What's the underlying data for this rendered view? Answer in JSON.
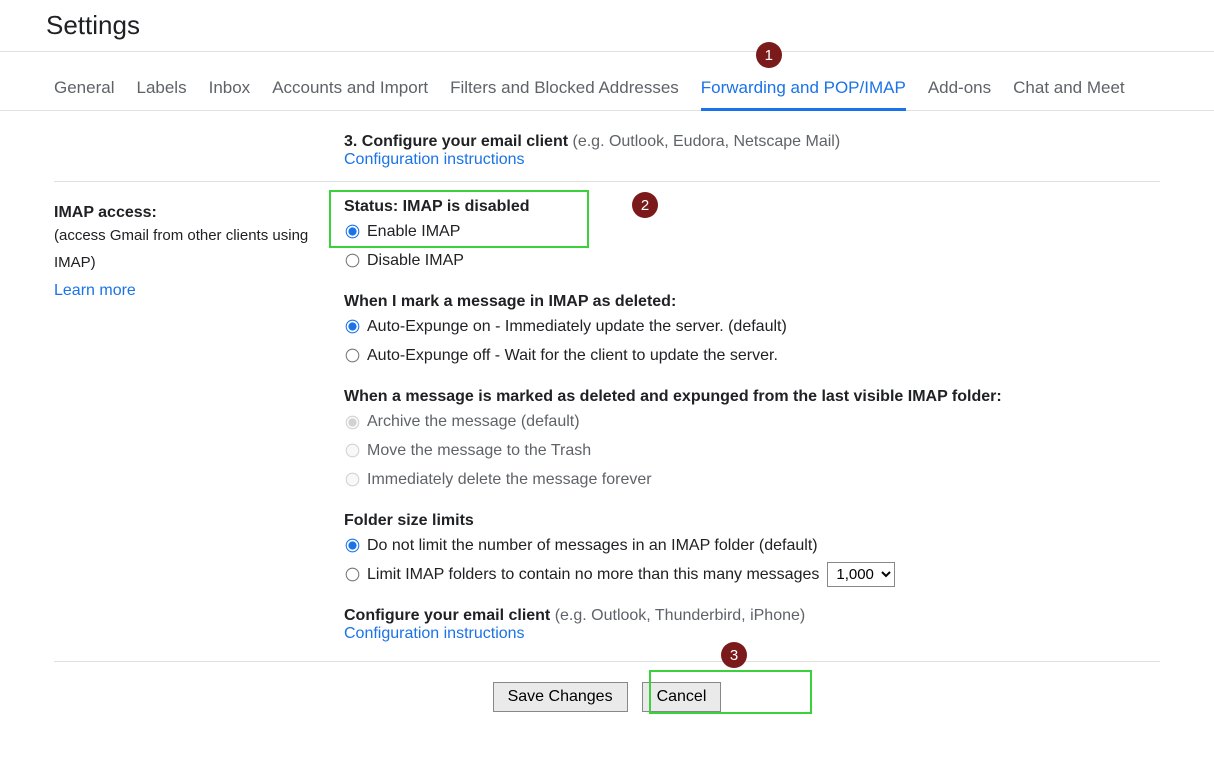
{
  "page": {
    "title": "Settings"
  },
  "tabs": {
    "general": "General",
    "labels": "Labels",
    "inbox": "Inbox",
    "accounts": "Accounts and Import",
    "filters": "Filters and Blocked Addresses",
    "forwarding": "Forwarding and POP/IMAP",
    "addons": "Add-ons",
    "chat": "Chat and Meet"
  },
  "pop": {
    "step3_label": "3. Configure your email client ",
    "step3_example": "(e.g. Outlook, Eudora, Netscape Mail)",
    "config_link": "Configuration instructions"
  },
  "imap": {
    "left_label": "IMAP access:",
    "left_sub": "(access Gmail from other clients using IMAP)",
    "learn_more": "Learn more",
    "status_label": "Status: IMAP is disabled",
    "enable": "Enable IMAP",
    "disable": "Disable IMAP",
    "deleted_heading": "When I mark a message in IMAP as deleted:",
    "deleted_opt1": "Auto-Expunge on - Immediately update the server. (default)",
    "deleted_opt2": "Auto-Expunge off - Wait for the client to update the server.",
    "expunged_heading": "When a message is marked as deleted and expunged from the last visible IMAP folder:",
    "expunged_opt1": "Archive the message (default)",
    "expunged_opt2": "Move the message to the Trash",
    "expunged_opt3": "Immediately delete the message forever",
    "folder_heading": "Folder size limits",
    "folder_opt1": "Do not limit the number of messages in an IMAP folder (default)",
    "folder_opt2": "Limit IMAP folders to contain no more than this many messages",
    "folder_select_value": "1,000",
    "configure_label": "Configure your email client ",
    "configure_example": "(e.g. Outlook, Thunderbird, iPhone)",
    "config_link": "Configuration instructions"
  },
  "buttons": {
    "save": "Save Changes",
    "cancel": "Cancel"
  },
  "callouts": {
    "c1": "1",
    "c2": "2",
    "c3": "3"
  }
}
